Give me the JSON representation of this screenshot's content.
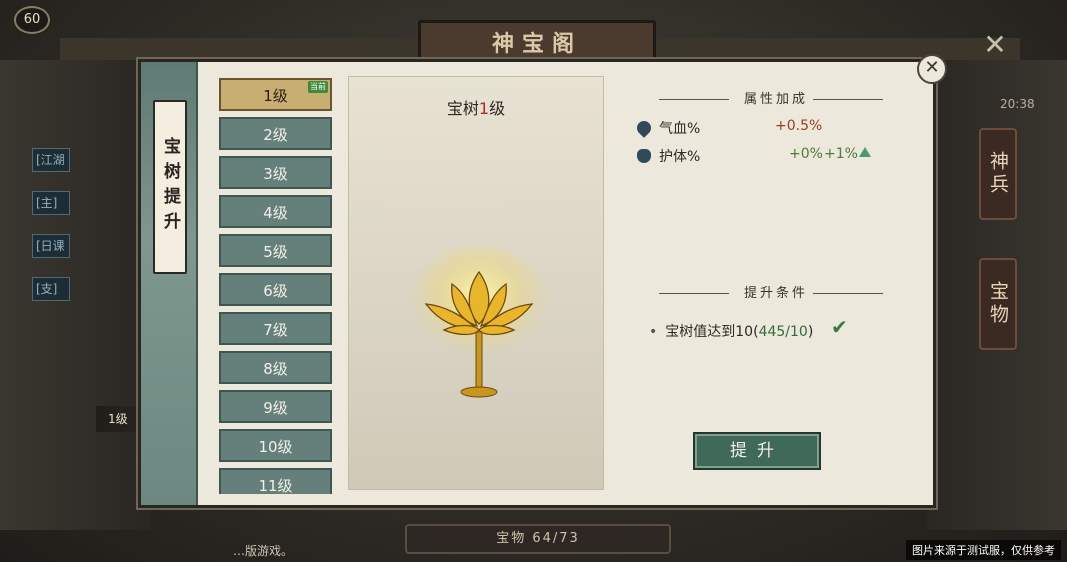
{
  "header": {
    "title": "神宝阁",
    "player_level": "60"
  },
  "left_hud": {
    "tags": [
      "[江湖",
      "[主]",
      "[日课",
      "[支]"
    ],
    "level_label": "1级"
  },
  "right_hud": {
    "time": "20:38",
    "buttons": [
      "神兵",
      "宝物"
    ]
  },
  "dialog": {
    "side_tab": "宝树提升",
    "levels": [
      "1级",
      "2级",
      "3级",
      "4级",
      "5级",
      "6级",
      "7级",
      "8级",
      "9级",
      "10级",
      "11级"
    ],
    "selected_index": 0,
    "selected_badge": "当前",
    "preview": {
      "title_prefix": "宝树",
      "title_level": "1",
      "title_suffix": "级"
    },
    "attributes": {
      "section_title": "属性加成",
      "rows": [
        {
          "icon": "heart-icon",
          "name": "气血%",
          "current": "+0.5%"
        },
        {
          "icon": "shield-icon",
          "name": "护体%",
          "current": "+0%",
          "next": "+1%"
        }
      ]
    },
    "conditions": {
      "section_title": "提升条件",
      "items": [
        {
          "text": "宝树值达到10",
          "progress": "445/10",
          "met": true
        }
      ]
    },
    "upgrade_button": "提升"
  },
  "bottom": {
    "treasure_count": "宝物 64/73",
    "footer_text": "…版游戏。"
  },
  "watermark": "图片来源于测试服，仅供参考"
}
